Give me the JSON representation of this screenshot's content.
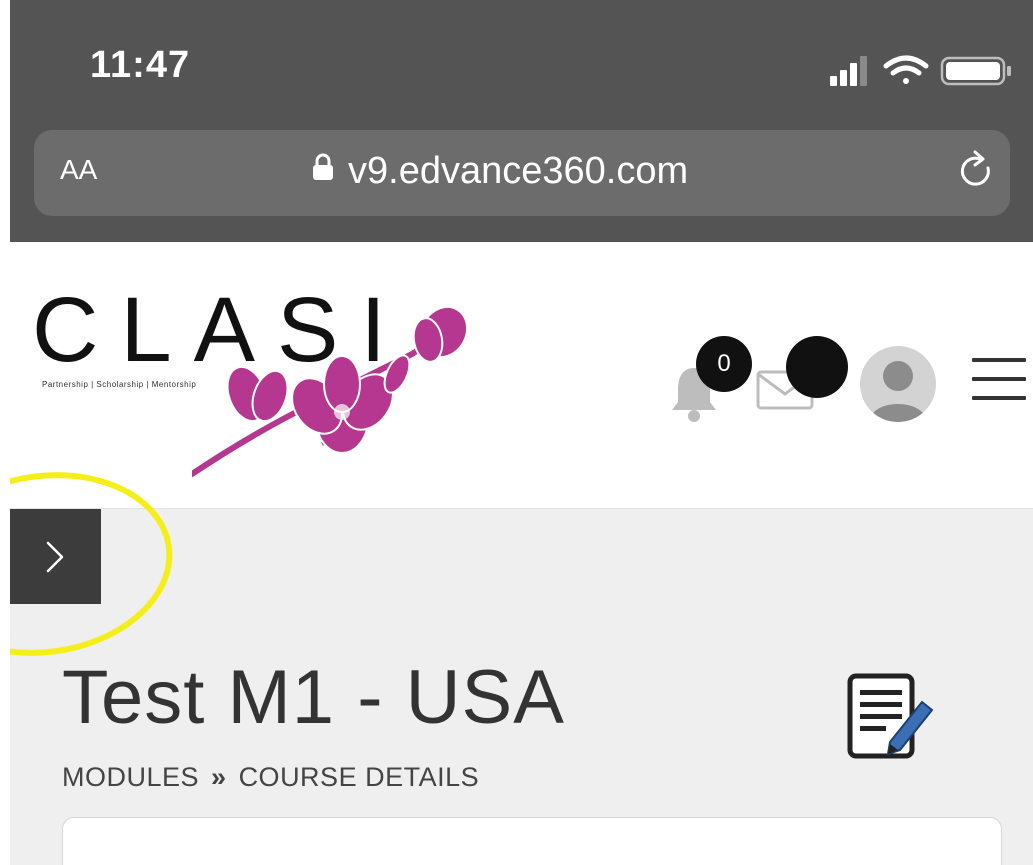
{
  "status_bar": {
    "time": "11:47",
    "icons": [
      "signal-icon",
      "wifi-icon",
      "battery-icon"
    ]
  },
  "browser": {
    "text_size_label": "AA",
    "url": "v9.edvance360.com",
    "icons": [
      "lock-icon",
      "reload-icon"
    ]
  },
  "header": {
    "logo_text": "CLASI",
    "logo_tagline": "Partnership | Scholarship | Mentorship",
    "notification_count": "0",
    "icons": [
      "bell-icon",
      "mail-icon",
      "avatar-icon",
      "hamburger-menu-icon"
    ]
  },
  "sidebar_toggle": {
    "icon": "chevron-right-icon"
  },
  "page": {
    "title": "Test M1 - USA",
    "breadcrumb": [
      "MODULES",
      "COURSE DETAILS"
    ],
    "breadcrumb_separator": "»",
    "icons": [
      "edit-notes-icon"
    ]
  },
  "colors": {
    "status_bar_bg": "#545454",
    "url_bar_bg": "#6c6c6c",
    "page_bg": "#efefef",
    "logo_flower": "#b5378f",
    "highlight_circle": "#f4ef1a",
    "sidebar_toggle_bg": "#3c3c3c"
  }
}
